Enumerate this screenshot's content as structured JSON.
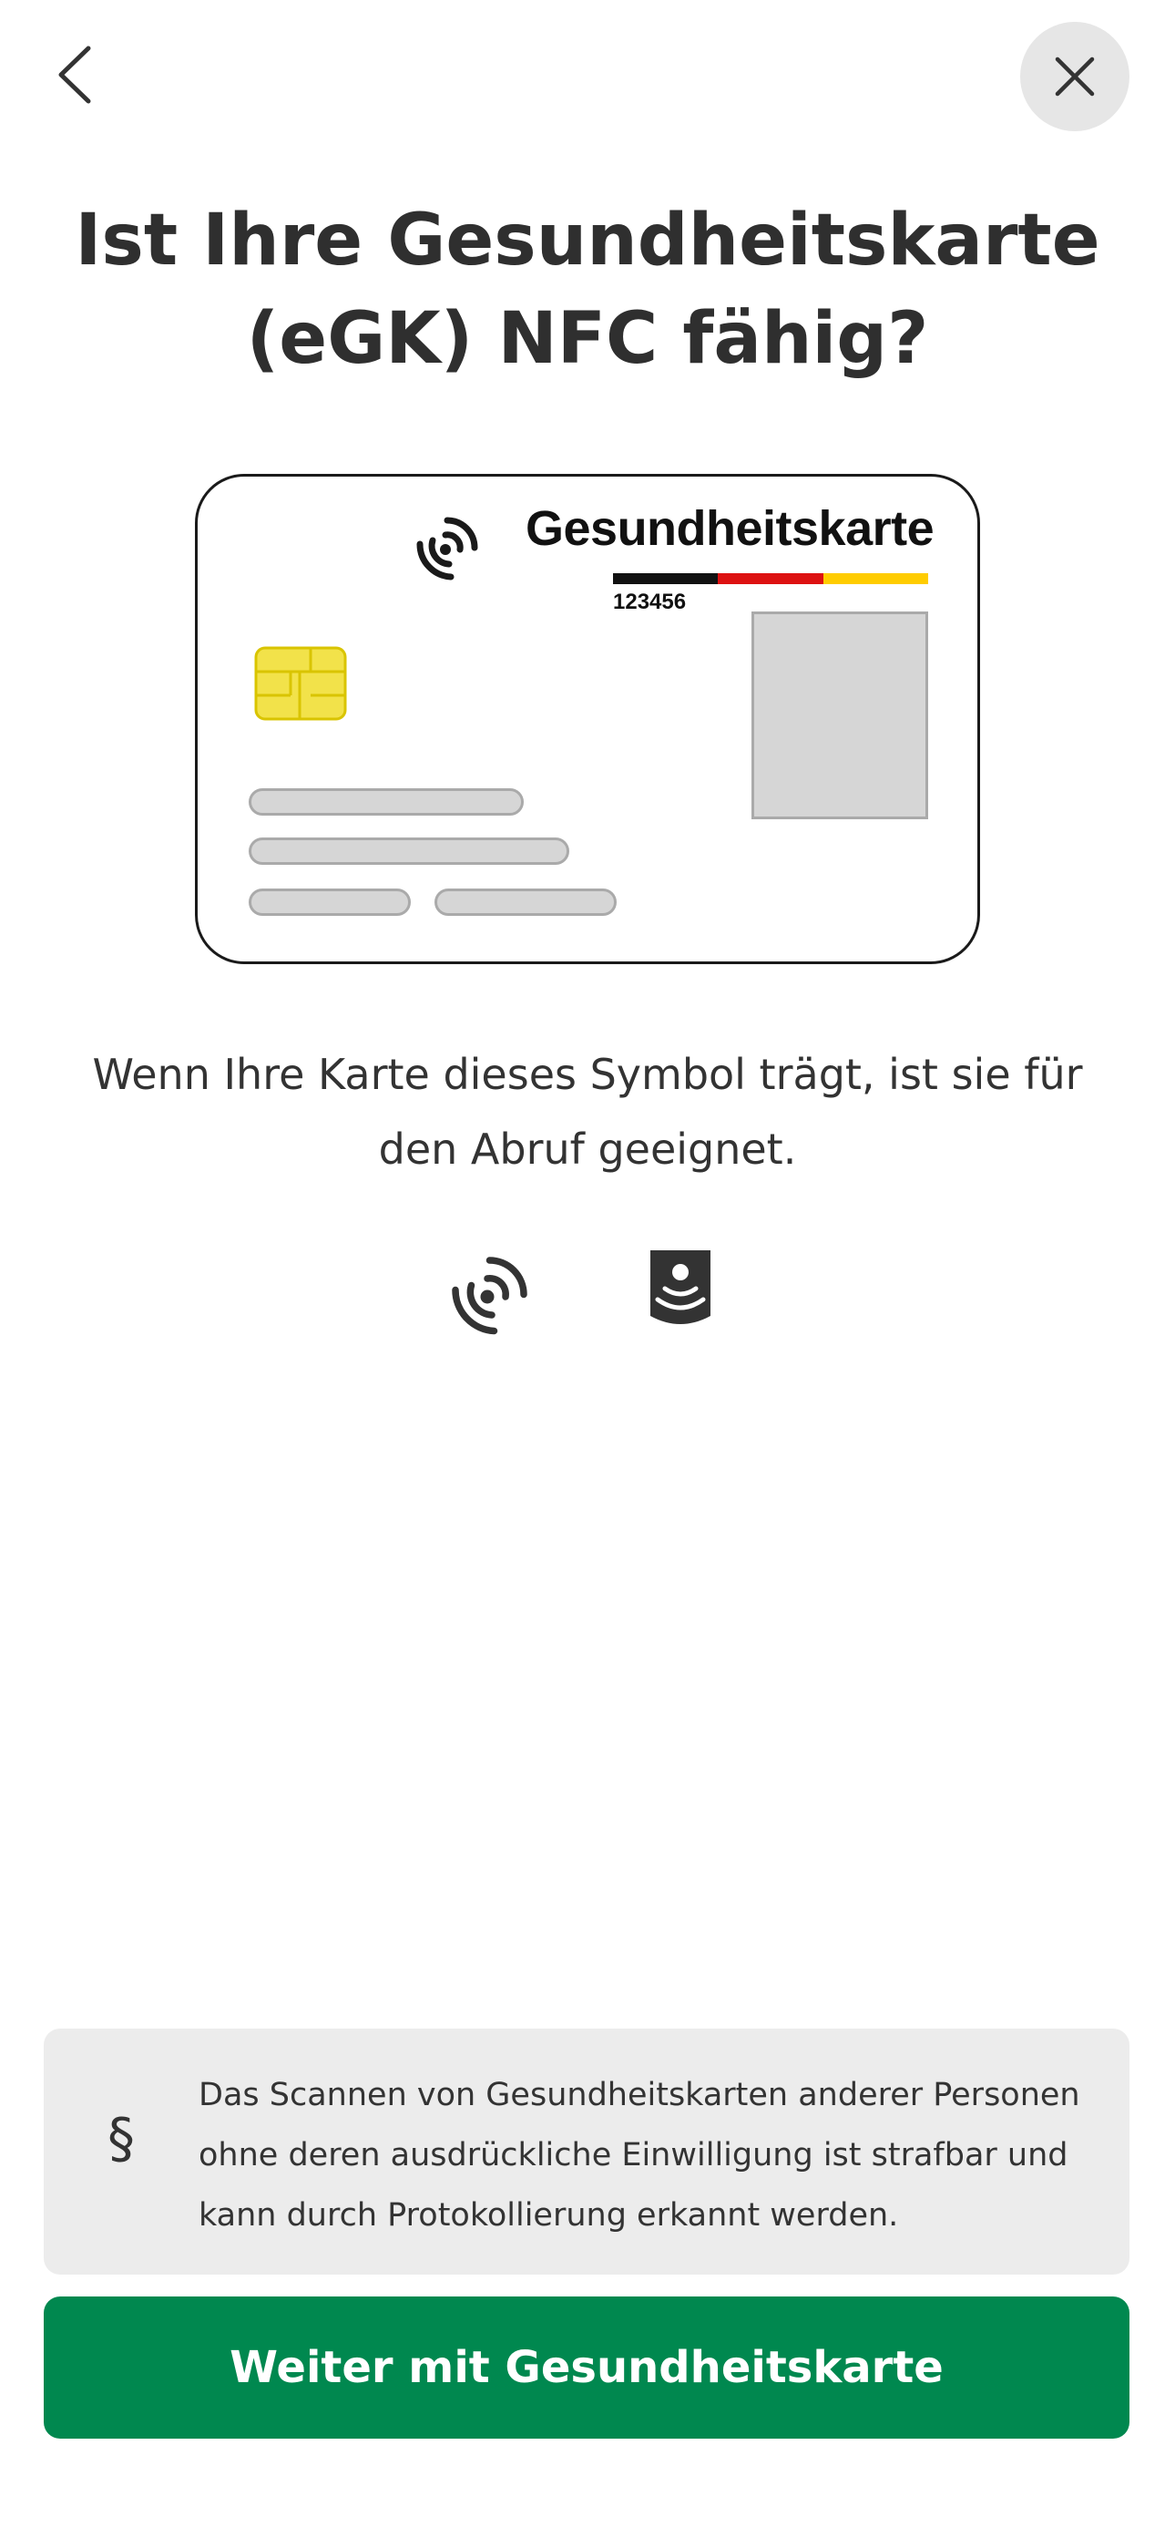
{
  "header": {
    "back_icon": "chevron-left-icon",
    "close_icon": "close-icon"
  },
  "title": "Ist Ihre Gesundheitskarte (eGK) NFC fähig?",
  "card": {
    "title": "Gesundheitskarte",
    "number": "123456",
    "flag_colors": [
      "#111111",
      "#dd1111",
      "#ffcc00"
    ],
    "chip_color": "#f2e24a"
  },
  "description": "Wenn Ihre Karte dieses Symbol trägt, ist sie für den Abruf geeignet.",
  "symbols": [
    "contactless-icon",
    "egk-nfc-icon"
  ],
  "legal": {
    "icon": "§",
    "text": "Das Scannen von Gesundheitskarten anderer Personen ohne deren ausdrückliche Einwilligung ist strafbar und kann durch Protokollierung erkannt werden."
  },
  "cta": {
    "label": "Weiter mit Gesundheitskarte",
    "color": "#00884f"
  }
}
